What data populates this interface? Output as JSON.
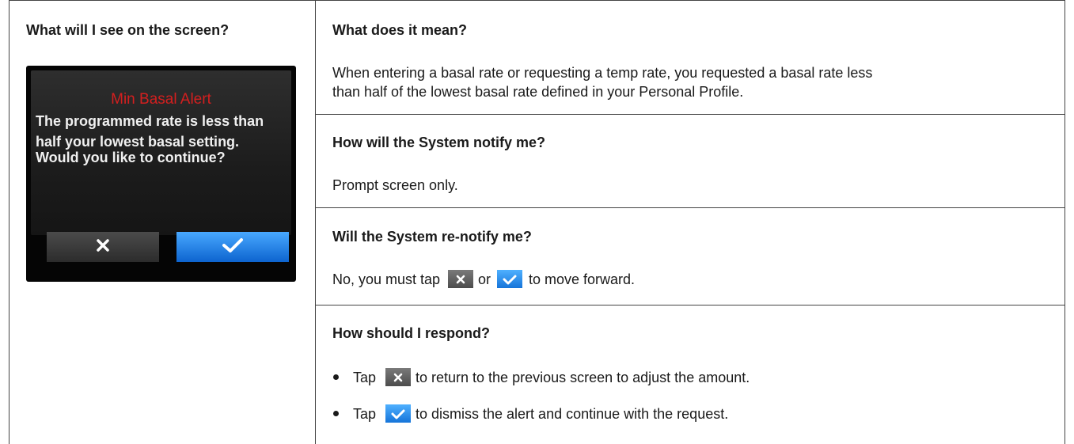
{
  "table": {
    "left_header": "What will I see on the screen?",
    "device_screen": {
      "title": "Min Basal Alert",
      "message_lines": [
        "The programmed rate is less than",
        "half your lowest basal setting.",
        "Would you like to continue?"
      ],
      "cancel_icon": "close-x-icon",
      "confirm_icon": "checkmark-icon",
      "title_color": "#d41f1f",
      "confirm_color": "#1e7fe8"
    },
    "right": {
      "meaning_header": "What does it mean?",
      "meaning_lines": [
        "When entering a basal rate or requesting a temp rate, you requested a basal rate less",
        "than half of the lowest basal rate defined in your Personal Profile."
      ],
      "notify_header": "How will the System notify me?",
      "notify_text": "Prompt screen only.",
      "renotify_header": "Will the System re-notify me?",
      "renotify_parts": [
        "No, you must tap",
        "or",
        "to move forward."
      ],
      "respond_header": "How should I respond?",
      "bullets": [
        {
          "pre": "Tap",
          "icon": "close-x-icon",
          "text": "to return to the previous screen to adjust the amount."
        },
        {
          "pre": "Tap",
          "icon": "checkmark-icon",
          "text": "to dismiss the alert and continue with the request."
        }
      ]
    }
  }
}
